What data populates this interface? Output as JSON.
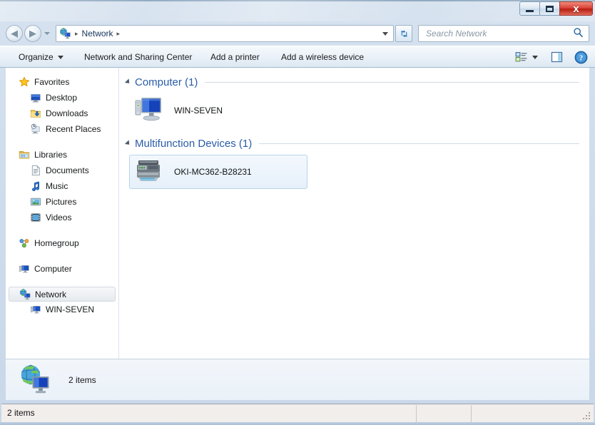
{
  "window": {
    "frame_color": "#cfdcec",
    "controls": {
      "minimize_label": "Minimize",
      "maximize_label": "Maximize",
      "close_label": "x"
    }
  },
  "navbar": {
    "back_label": "Back",
    "forward_label": "Forward",
    "recent_pages_label": "Recent pages",
    "breadcrumb": {
      "icon": "network-icon",
      "separator": "▸",
      "items": [
        "Network"
      ],
      "trailing_separator": "▸"
    },
    "refresh_label": "Refresh",
    "search": {
      "placeholder": "Search Network",
      "value": "",
      "icon": "search-icon"
    }
  },
  "toolbar": {
    "organize_label": "Organize",
    "network_sharing_label": "Network and Sharing Center",
    "add_printer_label": "Add a printer",
    "add_wireless_label": "Add a wireless device",
    "views_label": "Change your view",
    "preview_pane_label": "Show the preview pane",
    "help_label": "Help"
  },
  "sidebar": {
    "groups": [
      {
        "header": {
          "label": "Favorites",
          "icon": "star-icon"
        },
        "items": [
          {
            "label": "Desktop",
            "icon": "desktop-icon"
          },
          {
            "label": "Downloads",
            "icon": "downloads-icon"
          },
          {
            "label": "Recent Places",
            "icon": "recent-places-icon"
          }
        ]
      },
      {
        "header": {
          "label": "Libraries",
          "icon": "libraries-icon"
        },
        "items": [
          {
            "label": "Documents",
            "icon": "documents-icon"
          },
          {
            "label": "Music",
            "icon": "music-icon"
          },
          {
            "label": "Pictures",
            "icon": "pictures-icon"
          },
          {
            "label": "Videos",
            "icon": "videos-icon"
          }
        ]
      },
      {
        "header": {
          "label": "Homegroup",
          "icon": "homegroup-icon"
        },
        "items": []
      },
      {
        "header": {
          "label": "Computer",
          "icon": "computer-icon"
        },
        "items": []
      },
      {
        "header": {
          "label": "Network",
          "icon": "network-icon",
          "selected": true
        },
        "items": [
          {
            "label": "WIN-SEVEN",
            "icon": "computer-icon"
          }
        ]
      }
    ]
  },
  "content": {
    "groups": [
      {
        "title": "Computer (1)",
        "expanded": true,
        "items": [
          {
            "label": "WIN-SEVEN",
            "icon": "computer-large-icon",
            "hovered": false
          }
        ]
      },
      {
        "title": "Multifunction Devices (1)",
        "expanded": true,
        "items": [
          {
            "label": "OKI-MC362-B28231",
            "icon": "printer-large-icon",
            "hovered": true
          }
        ]
      }
    ]
  },
  "details_pane": {
    "icon": "network-large-icon",
    "text": "2 items"
  },
  "status_bar": {
    "text": "2 items"
  }
}
